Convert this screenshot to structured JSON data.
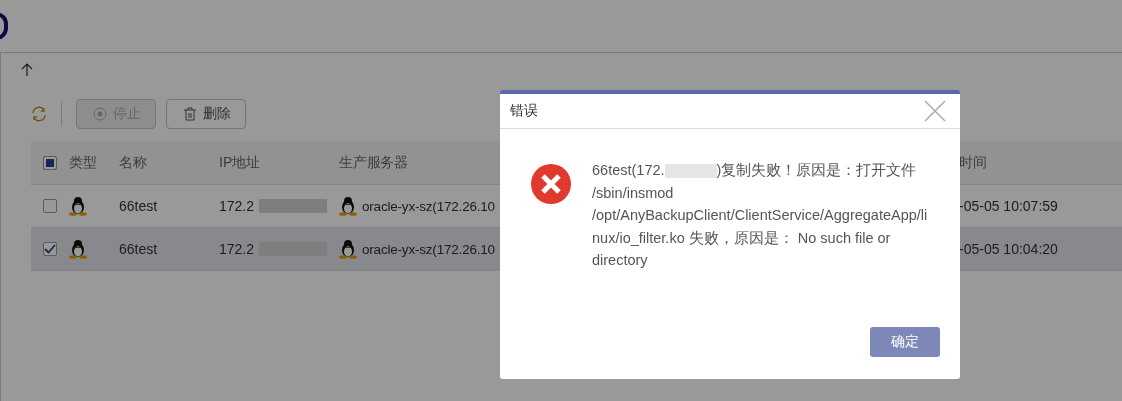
{
  "toolbar": {
    "buttons": [
      {
        "kind": "stop",
        "label": "停止",
        "disabled": true
      },
      {
        "kind": "delete",
        "label": "删除",
        "disabled": false
      }
    ]
  },
  "table": {
    "header_checkbox": {
      "indeterminate": true
    },
    "columns": [
      "类型",
      "名称",
      "IP地址",
      "生产服务器",
      "时间"
    ],
    "rows": [
      {
        "selected": false,
        "checked": false,
        "name": "66test",
        "ip": "172.2",
        "server": "oracle-yx-sz(172.26.10",
        "time": "-05-05 10:07:59"
      },
      {
        "selected": true,
        "checked": true,
        "name": "66test",
        "ip": "172.2",
        "server": "oracle-yx-sz(172.26.10",
        "time": "-05-05 10:04:20"
      }
    ]
  },
  "dialog": {
    "title": "错误",
    "message_start": "66test(172.",
    "message_rest": ")复制失败！原因是：打开文件 /sbin/insmod /opt/AnyBackupClient/ClientService/AggregateApp/linux/io_filter.ko 失败，原因是： No such file or directory",
    "ok": "确定"
  }
}
